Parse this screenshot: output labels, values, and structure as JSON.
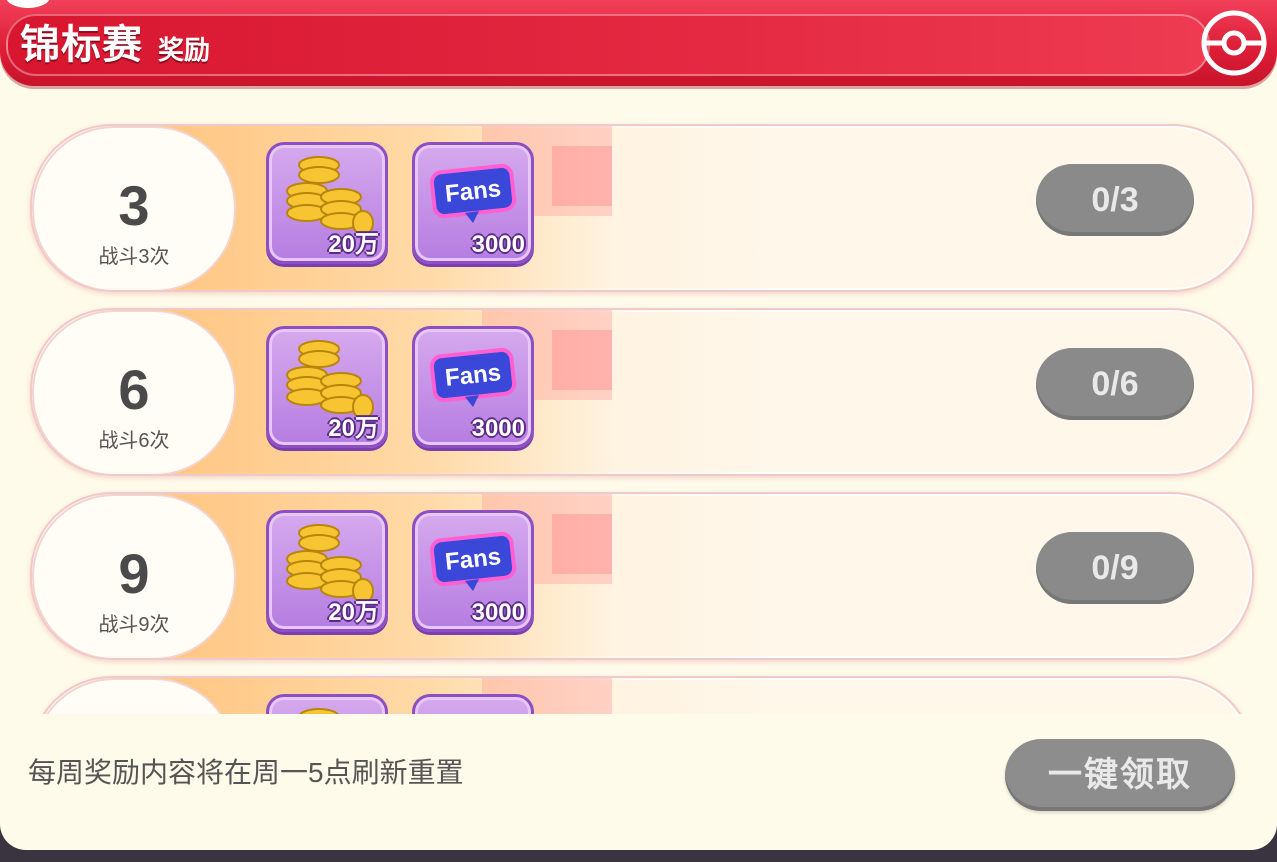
{
  "header": {
    "title": "锦标赛",
    "subtitle": "奖励",
    "accent_color": "#dd1f37"
  },
  "rewards": [
    {
      "count": "3",
      "label": "战斗3次",
      "items": [
        {
          "icon": "gold-coins-icon",
          "amount": "20万"
        },
        {
          "icon": "fans-ticket-icon",
          "amount": "3000"
        }
      ],
      "progress": "0/3"
    },
    {
      "count": "6",
      "label": "战斗6次",
      "items": [
        {
          "icon": "gold-coins-icon",
          "amount": "20万"
        },
        {
          "icon": "fans-ticket-icon",
          "amount": "3000"
        }
      ],
      "progress": "0/6"
    },
    {
      "count": "9",
      "label": "战斗9次",
      "items": [
        {
          "icon": "gold-coins-icon",
          "amount": "20万"
        },
        {
          "icon": "fans-ticket-icon",
          "amount": "3000"
        }
      ],
      "progress": "0/9"
    },
    {
      "count": "",
      "label": "",
      "items": [
        {
          "icon": "gold-coins-icon",
          "amount": ""
        },
        {
          "icon": "fans-ticket-icon",
          "amount": ""
        }
      ],
      "progress": ""
    }
  ],
  "footer": {
    "note": "每周奖励内容将在周一5点刷新重置",
    "claim_all_label": "一键领取"
  },
  "fans_logo_text": "Fans"
}
